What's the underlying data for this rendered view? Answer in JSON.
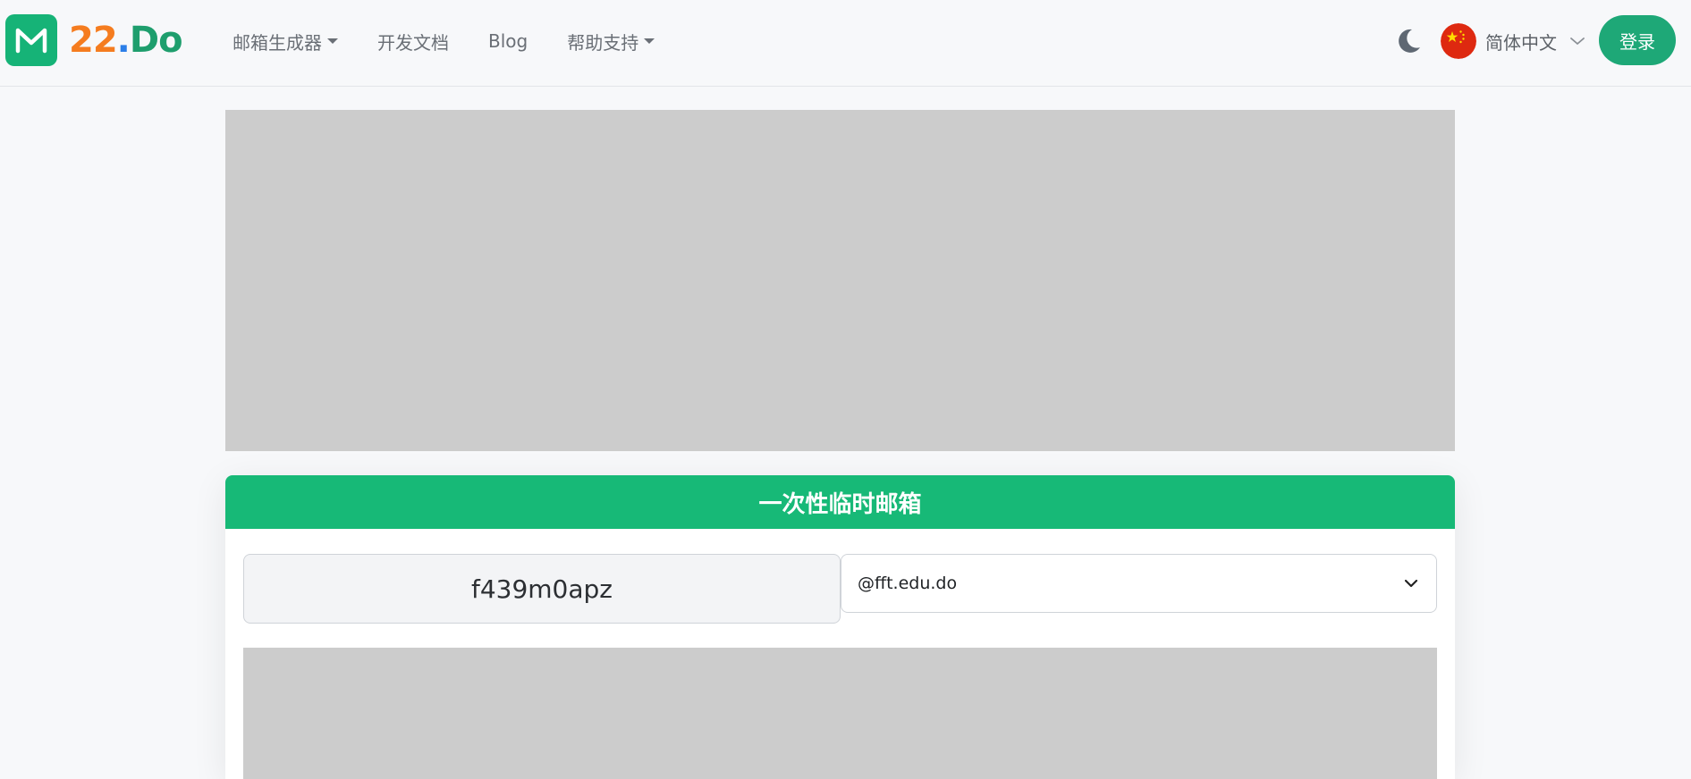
{
  "brand": {
    "logo_icon": "mail-m-icon",
    "number": "22",
    "dot": ".",
    "suffix": "Do",
    "colors": {
      "icon_bg": "#16b377",
      "number": "#f57c1f",
      "dot": "#2b7ee8",
      "suffix": "#1e9e6d"
    }
  },
  "nav": {
    "items": [
      {
        "label": "邮箱生成器",
        "dropdown": true
      },
      {
        "label": "开发文档",
        "dropdown": false
      },
      {
        "label": "Blog",
        "dropdown": false
      },
      {
        "label": "帮助支持",
        "dropdown": true
      }
    ]
  },
  "header_right": {
    "theme_toggle_icon": "moon-icon",
    "language": {
      "flag_icon": "china-flag-icon",
      "label": "简体中文"
    },
    "login_label": "登录",
    "accent": "#1ea877"
  },
  "card": {
    "title": "一次性临时邮箱",
    "header_color": "#17b977",
    "email_name": "f439m0apz",
    "domain": "@fft.edu.do"
  }
}
